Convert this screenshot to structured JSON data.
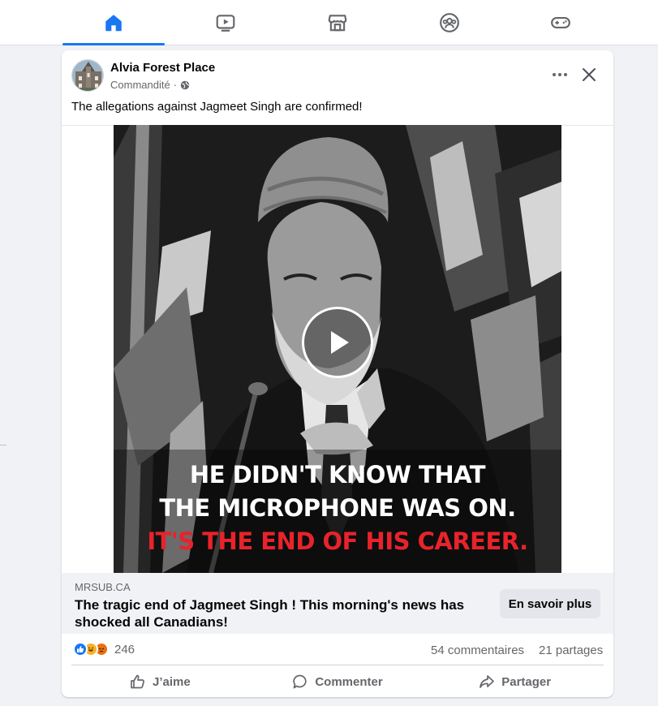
{
  "nav": {
    "tabs": [
      {
        "name": "home",
        "icon": "home-icon",
        "active": true
      },
      {
        "name": "watch",
        "icon": "video-icon",
        "active": false
      },
      {
        "name": "marketplace",
        "icon": "marketplace-icon",
        "active": false
      },
      {
        "name": "groups",
        "icon": "groups-icon",
        "active": false
      },
      {
        "name": "gaming",
        "icon": "gaming-icon",
        "active": false
      }
    ],
    "accent": "#1877f2"
  },
  "post": {
    "author": "Alvia Forest Place",
    "sponsored_label": "Commandité",
    "separator": "·",
    "text": "The allegations against Jagmeet Singh are confirmed!",
    "media": {
      "caption_line1": "HE DIDN'T KNOW THAT",
      "caption_line2": "THE MICROPHONE WAS ON.",
      "caption_line3": "IT'S THE END OF HIS CAREER.",
      "caption_highlight_color": "#e8232b"
    },
    "link": {
      "domain": "MRSUB.CA",
      "title": "The tragic end of Jagmeet Singh ! This morning's news has shocked all Canadians!",
      "cta_label": "En savoir plus"
    },
    "stats": {
      "reaction_count": "246",
      "comments": "54 commentaires",
      "shares": "21 partages"
    },
    "actions": {
      "like": "J’aime",
      "comment": "Commenter",
      "share": "Partager"
    }
  }
}
